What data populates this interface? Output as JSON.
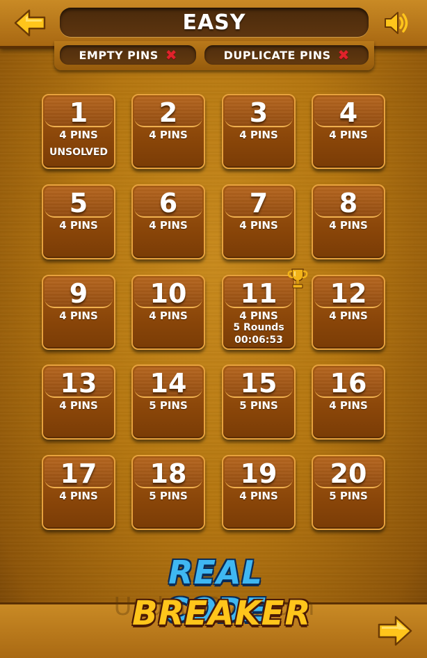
{
  "header": {
    "title": "EASY",
    "back_icon": "arrow-left-icon",
    "sound_icon": "speaker-icon"
  },
  "options": {
    "empty_pins": {
      "label": "EMPTY PINS",
      "state_icon": "x-icon"
    },
    "duplicate_pins": {
      "label": "DUPLICATE PINS",
      "state_icon": "x-icon"
    }
  },
  "levels": [
    {
      "number": "1",
      "pins": "4 PINS",
      "status": "UNSOLVED"
    },
    {
      "number": "2",
      "pins": "4 PINS"
    },
    {
      "number": "3",
      "pins": "4 PINS"
    },
    {
      "number": "4",
      "pins": "4 PINS"
    },
    {
      "number": "5",
      "pins": "4 PINS"
    },
    {
      "number": "6",
      "pins": "4 PINS"
    },
    {
      "number": "7",
      "pins": "4 PINS"
    },
    {
      "number": "8",
      "pins": "4 PINS"
    },
    {
      "number": "9",
      "pins": "4 PINS"
    },
    {
      "number": "10",
      "pins": "4 PINS"
    },
    {
      "number": "11",
      "pins": "4 PINS",
      "rounds": "5 Rounds",
      "time": "00:06:53",
      "trophy": true
    },
    {
      "number": "12",
      "pins": "4 PINS"
    },
    {
      "number": "13",
      "pins": "4 PINS"
    },
    {
      "number": "14",
      "pins": "5 PINS"
    },
    {
      "number": "15",
      "pins": "5 PINS"
    },
    {
      "number": "16",
      "pins": "4 PINS"
    },
    {
      "number": "17",
      "pins": "4 PINS"
    },
    {
      "number": "18",
      "pins": "5 PINS"
    },
    {
      "number": "19",
      "pins": "4 PINS"
    },
    {
      "number": "20",
      "pins": "5 PINS"
    }
  ],
  "logo": {
    "line1": "REAL CODE",
    "line2": "BREAKER"
  },
  "watermark": "UpdateStar.com",
  "footer": {
    "next_icon": "arrow-right-icon"
  },
  "colors": {
    "accent_yellow": "#ffc51b",
    "cross_red": "#e0232b",
    "logo_blue": "#3fb7f2"
  }
}
